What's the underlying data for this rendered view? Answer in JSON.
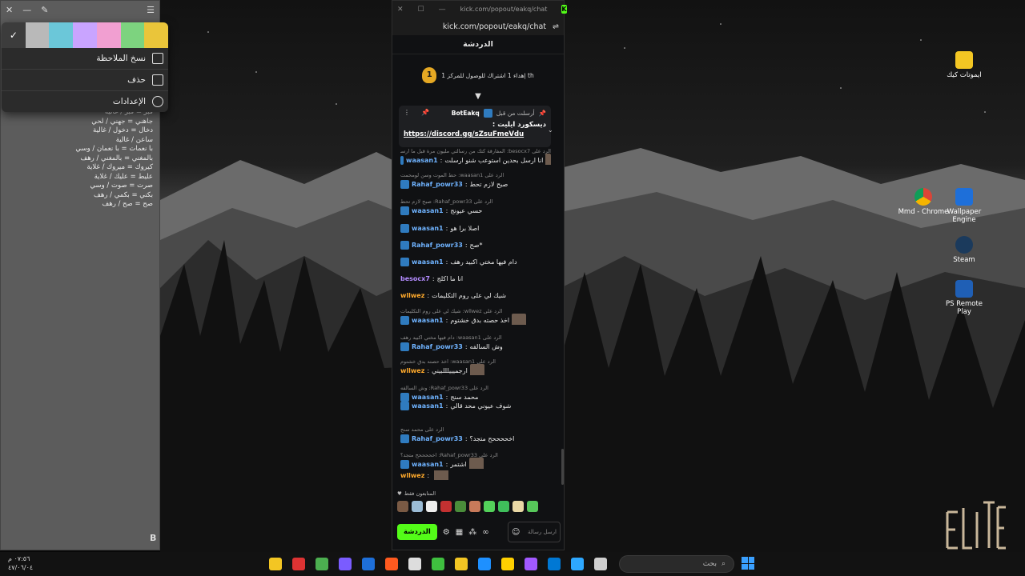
{
  "desktop": {
    "icons": [
      {
        "name": "desktop-icon-kick-emotes",
        "label": "ايموتات كيك"
      },
      {
        "name": "desktop-icon-chrome",
        "label": "Mmd - Chrome"
      },
      {
        "name": "desktop-icon-wallpaper-engine",
        "label": "Wallpaper Engine"
      },
      {
        "name": "desktop-icon-steam",
        "label": "Steam"
      },
      {
        "name": "desktop-icon-ps-remote-play",
        "label": "PS Remote Play"
      }
    ]
  },
  "sticky_note": {
    "menu": {
      "copy": "نسخ الملاحظة",
      "delete": "حذف",
      "settings": "الإعدادات",
      "check": "✓"
    },
    "swatch_colors": [
      "#3c3c3c",
      "#b9b9b9",
      "#6bc7d9",
      "#c9a4ff",
      "#f19fd1",
      "#7dd37f",
      "#eac53a"
    ],
    "lines": [
      "قبر = قبر / غالية",
      "جاهني = جهني / لحي",
      "دخال = دخول / غالية",
      "ساعن / غالية",
      "با نعمات = با نعمان / وسي",
      "بالمغني = بالمغني / رهف",
      "كيروك = ميروك / غلاية",
      "عليط = عليك / غلاية",
      "صرت = صوت / وسي",
      "بكني = بكمي / رهف",
      "صح = صح / رهف"
    ],
    "bottom_letter": "B"
  },
  "popout": {
    "window_title": "kick.com/popout/eakq/chat",
    "url": "kick.com/popout/eakq/chat",
    "header": "الدردشة",
    "goal_text": "إهداء 1 اشتراك للوصول للمركز 1 th",
    "goal_rank": "1",
    "pinned": {
      "label": "أرسلت من قبل",
      "author": "BotEakq",
      "body": "ديسكورد ايليت :",
      "link": "https://discord.gg/sZsuFmeVdu"
    },
    "messages": [
      {
        "reply": "الرد على besocx7: المفارقة كتك من رسالتي مليون مرة قبل ما ارسل",
        "user": "waasan1",
        "color": "blue",
        "text": "انا ارسل بحدين استوعب شنو ارسلت",
        "thumb": true
      },
      {
        "reply": "الرد على waasan1: حط الموت وسن لومحمت",
        "user": "Rahaf_powr33",
        "color": "blue",
        "text": "صبح لازم تحط"
      },
      {
        "reply": "الرد على Rahaf_powr33: صبح لازم تحط",
        "user": "waasan1",
        "color": "blue",
        "text": "حسي عيونج"
      },
      {
        "reply": "",
        "user": "waasan1",
        "color": "blue",
        "text": "اصلا برا هو"
      },
      {
        "reply": "",
        "user": "Rahaf_powr33",
        "color": "blue",
        "text": "صح*"
      },
      {
        "reply": "",
        "user": "waasan1",
        "color": "blue",
        "text": "دام فيها مختي اكبيد رهف"
      },
      {
        "reply": "",
        "user": "besocx7",
        "color": "purple",
        "text": "انا ما اكلج"
      },
      {
        "reply": "",
        "user": "wllwez",
        "color": "orange",
        "text": "شيك لي على روم التكليمات"
      },
      {
        "reply": "الرد على wllwez: شيك لي على روم التكليمات",
        "user": "waasan1",
        "color": "blue",
        "text": "اخذ حصته بدق خشتوم",
        "thumb": true
      },
      {
        "reply": "الرد على waasan1: دام فيها مختي اكبيد رهف",
        "user": "Rahaf_powr33",
        "color": "blue",
        "text": "وش السالفه"
      },
      {
        "reply": "الرد على waasan1: اخذ حصته بدق خشتوم",
        "user": "wllwez",
        "color": "orange",
        "text": "ارجميييلللبيني",
        "thumb": true
      },
      {
        "reply": "الرد على Rahaf_powr33: وش السالفه",
        "user": "waasan1",
        "color": "blue",
        "text": "محمد سنج"
      },
      {
        "reply": "",
        "user": "waasan1",
        "color": "blue",
        "text": "شوف عيوني محد قالي"
      },
      {
        "reply": "الرد على محمد سنج",
        "user": "Rahaf_powr33",
        "color": "blue",
        "text": "اخححححح متجد؟"
      },
      {
        "reply": "الرد على Rahaf_powr33: اخححححح متجد؟",
        "user": "waasan1",
        "color": "blue",
        "text": "اشتمر",
        "thumb": true
      },
      {
        "reply": "",
        "user": "wllwez",
        "color": "orange",
        "text": "",
        "thumb": true
      }
    ],
    "emotes_title": "المتابعون فقط",
    "emote_colors": [
      "#7a5a44",
      "#9bbcd6",
      "#eeeeee",
      "#c33131",
      "#4a8d3a",
      "#c87a5a",
      "#53d15a",
      "#3fbf5b",
      "#e9d7a4",
      "#57c85a"
    ],
    "send_label": "الدردشة",
    "input_placeholder": "ارسل رسالة"
  },
  "taskbar": {
    "clock_time": "٠٧:٥٦ م",
    "clock_date": "٤٧/٠٦/٠٤",
    "search_placeholder": "بحث",
    "app_colors": [
      "#f3c623",
      "#d33",
      "#4caf50",
      "#7a5cff",
      "#1e6fd9",
      "#ff5a1f",
      "#ddd",
      "#3fbf3f",
      "#f3c623",
      "#1e90ff",
      "#ffd000",
      "#a259ff",
      "#0078d4",
      "#2ea8ff",
      "#cfcfcf"
    ]
  }
}
